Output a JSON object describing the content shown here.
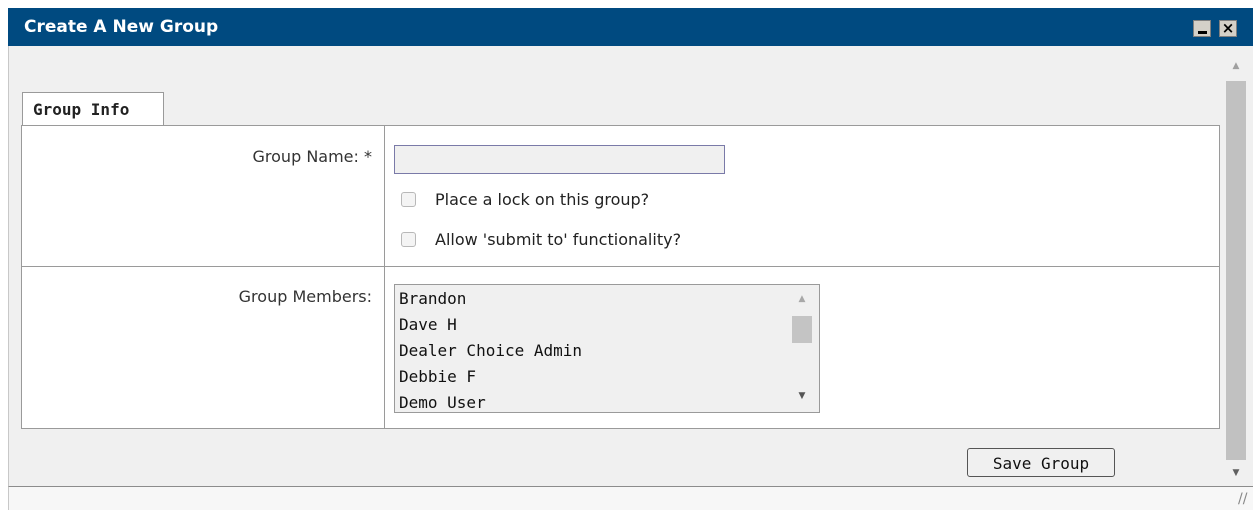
{
  "window": {
    "title": "Create A New Group",
    "min_icon": "minimize-icon",
    "close_icon": "close-icon",
    "close_glyph": "×",
    "title_bar_color": "#004a80"
  },
  "tabs": [
    {
      "label": "Group Info",
      "active": true
    }
  ],
  "form": {
    "group_name_label": "Group Name: *",
    "group_name_value": "",
    "lock_label": "Place a lock on this group?",
    "lock_checked": false,
    "submit_to_label": "Allow 'submit to' functionality?",
    "submit_to_checked": false,
    "members_label": "Group Members:",
    "members": [
      "Brandon",
      "Dave H",
      "Dealer Choice Admin",
      "Debbie F",
      "Demo User"
    ]
  },
  "actions": {
    "save_label": "Save Group"
  }
}
